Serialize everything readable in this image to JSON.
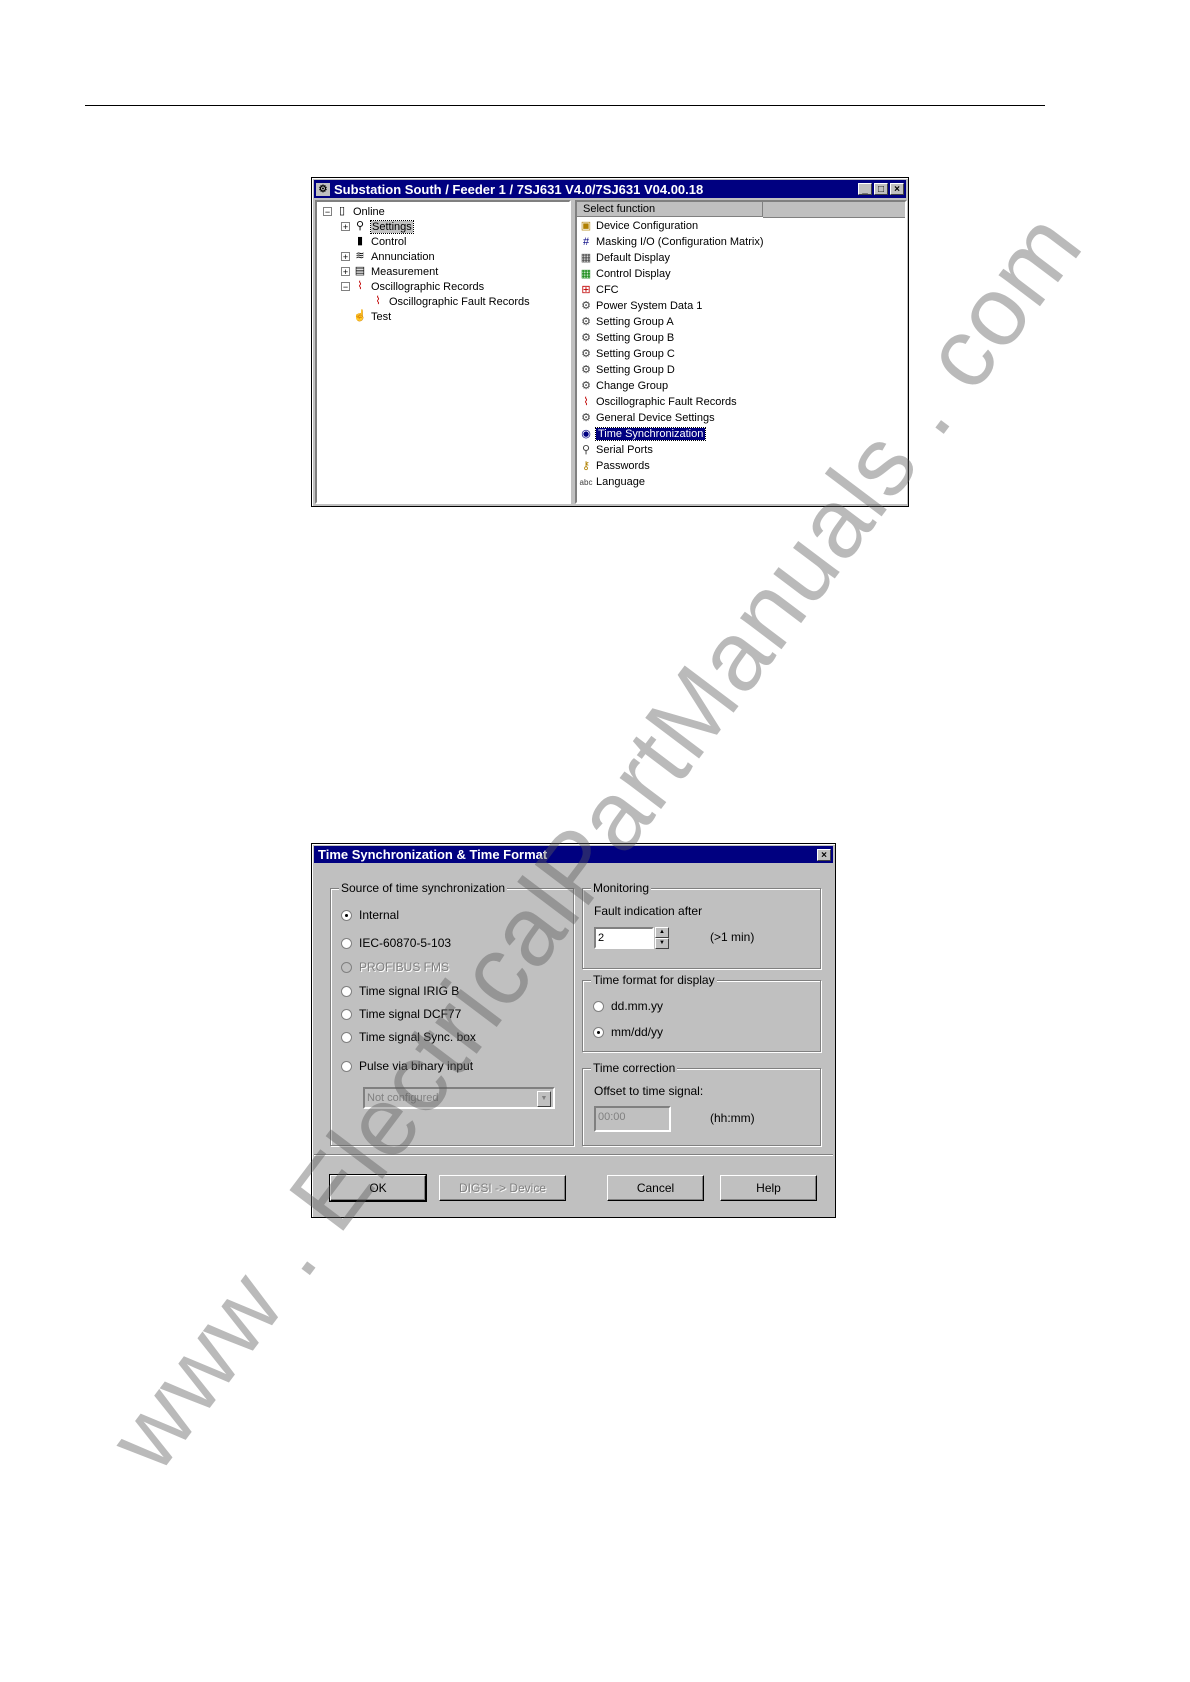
{
  "window1": {
    "title": "Substation South / Feeder 1 / 7SJ631 V4.0/7SJ631 V04.00.18",
    "tree": [
      {
        "label": "Online",
        "expander": "−",
        "icon": "▯"
      },
      {
        "label": "Settings",
        "expander": "+",
        "icon": "⚲"
      },
      {
        "label": "Control",
        "expander": "",
        "icon": "▮"
      },
      {
        "label": "Annunciation",
        "expander": "+",
        "icon": "≋"
      },
      {
        "label": "Measurement",
        "expander": "+",
        "icon": "▤"
      },
      {
        "label": "Oscillographic Records",
        "expander": "−",
        "icon": "⌇"
      },
      {
        "label": "Oscillographic Fault Records",
        "expander": "",
        "icon": "⌇"
      },
      {
        "label": "Test",
        "expander": "",
        "icon": "☝"
      }
    ],
    "list_header": "Select function",
    "functions": [
      "Device Configuration",
      "Masking I/O (Configuration Matrix)",
      "Default Display",
      "Control Display",
      "CFC",
      "Power System Data 1",
      "Setting Group A",
      "Setting Group B",
      "Setting Group C",
      "Setting Group D",
      "Change Group",
      "Oscillographic Fault Records",
      "General Device Settings",
      "Time Synchronization",
      "Serial Ports",
      "Passwords",
      "Language"
    ],
    "selected_function": "Time Synchronization"
  },
  "dialog": {
    "title": "Time Synchronization & Time Format",
    "source_group": {
      "label": "Source of time synchronization",
      "options": [
        {
          "label": "Internal",
          "checked": true,
          "disabled": false
        },
        {
          "label": "IEC-60870-5-103",
          "checked": false,
          "disabled": false
        },
        {
          "label": "PROFIBUS FMS",
          "checked": false,
          "disabled": true
        },
        {
          "label": "Time signal IRIG B",
          "checked": false,
          "disabled": false
        },
        {
          "label": "Time signal DCF77",
          "checked": false,
          "disabled": false
        },
        {
          "label": "Time signal Sync. box",
          "checked": false,
          "disabled": false
        },
        {
          "label": "Pulse via binary input",
          "checked": false,
          "disabled": false
        }
      ],
      "binary_input_select": "Not configured"
    },
    "monitoring": {
      "label": "Monitoring",
      "fault_label": "Fault indication after",
      "value": "2",
      "unit": "(>1 min)"
    },
    "time_format": {
      "label": "Time format for display",
      "options": [
        {
          "label": "dd.mm.yy",
          "checked": false
        },
        {
          "label": "mm/dd/yy",
          "checked": true
        }
      ]
    },
    "time_correction": {
      "label": "Time correction",
      "offset_label": "Offset to time signal:",
      "value": "00:00",
      "unit": "(hh:mm)"
    },
    "buttons": {
      "ok": "OK",
      "digsi": "DIGSI -> Device",
      "cancel": "Cancel",
      "help": "Help"
    }
  },
  "watermark": "www . ElectricalPartManuals . com"
}
